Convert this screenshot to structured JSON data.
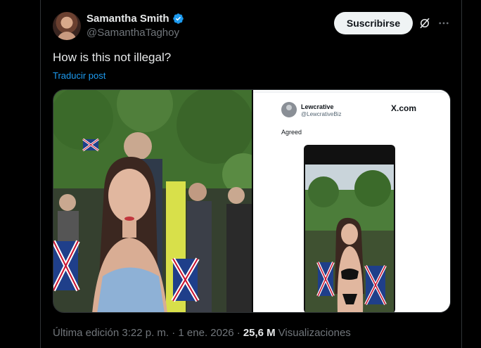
{
  "author": {
    "name": "Samantha Smith",
    "handle": "@SamanthaTaghoy",
    "verified_color": "#1d9bf0"
  },
  "actions": {
    "subscribe_label": "Suscribirse",
    "grok_icon": "grok-icon",
    "more_icon": "more-horizontal-icon"
  },
  "post": {
    "text": "How is this not illegal?",
    "translate_label": "Traducir post"
  },
  "embedded_post": {
    "author_name": "Lewcrative",
    "author_handle": "@LewcrativeBiz",
    "site": "X.com",
    "text": "Agreed"
  },
  "footer": {
    "edited_label": "Última edición 3:22 p. m. · 1 ene. 2026 ·",
    "views_count": "25,6 M",
    "views_label": "Visualizaciones"
  },
  "colors": {
    "background": "#000000",
    "text_primary": "#e7e9ea",
    "text_secondary": "#71767b",
    "link": "#1d9bf0",
    "border": "#2f3336"
  }
}
